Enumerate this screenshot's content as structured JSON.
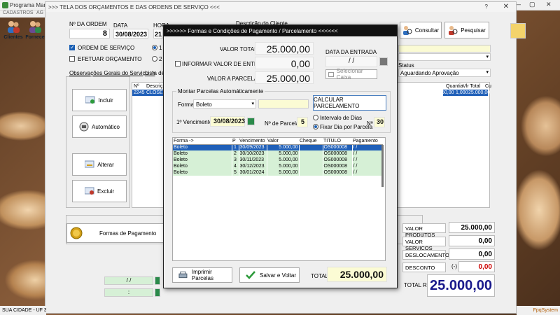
{
  "app": {
    "title": "Programa Mani",
    "menu": [
      "CADASTROS",
      "AG"
    ],
    "window_controls": {
      "minimize": "—",
      "maximize": "▢",
      "close": "✕"
    }
  },
  "toolbar": {
    "clientes": "Clientes",
    "fornece": "Fornece"
  },
  "main_form": {
    "title": ">>>  TELA DOS ORÇAMENTOS E DAS ORDENS DE SERVIÇO  <<<",
    "help": "?",
    "close": "✕",
    "numero_label": "Nº DA ORDEM",
    "numero_value": "8",
    "data_label": "DATA",
    "data_value": "30/08/2023",
    "hora_label": "HORA",
    "hora_value": "21",
    "ordem_servico": "ORDEM DE SERVIÇO",
    "efetuar_orcamento": "EFETUAR ORÇAMENTO",
    "radio1": "1",
    "radio2": "2",
    "descricao_cliente": "Descrição do Cliente",
    "consultar": "Consultar",
    "pesquisar": "Pesquisar",
    "status_label": "Status",
    "status_value": "Aguardando Aprovação",
    "tab_obs": "Observações Gerais do Serviço ->",
    "tab_lista": "Lista de P",
    "grid_head": [
      "Nº",
      "Descriç"
    ],
    "grid_row": [
      "2245",
      "CLOSET"
    ],
    "grid_right_head": [
      "",
      "Quantia",
      "Vlr Total",
      "Cu"
    ],
    "grid_right_row": [
      "50,00",
      "1,000",
      "25.000,00",
      ""
    ],
    "btn_incluir": "Incluir",
    "btn_automatico": "Automático",
    "btn_alterar": "Alterar",
    "btn_excluir": "Excluir",
    "btn_formas": "Formas de Pagamento",
    "date_slash": "/ /",
    "time_colon": ":",
    "valor_produtos_label": "VALOR PRODUTOS",
    "valor_produtos": "25.000,00",
    "valor_servicos_label": "VALOR SERVICOS",
    "valor_servicos": "0,00",
    "deslocamento_label": "DESLOCAMENTO",
    "deslocamento": "0,00",
    "desconto_label": "DESCONTO",
    "desconto_sign": "(-)",
    "desconto": "0,00",
    "total_label": "TOTAL R$",
    "total": "25.000,00"
  },
  "statusbar": {
    "left": "SUA CIDADE - UF 3",
    "right": "FpqSystem"
  },
  "modal": {
    "title": ">>>>>>  Formas e Condições de Pagamento / Parcelamento  <<<<<<",
    "valor_total_label": "VALOR TOTAL",
    "valor_total": "25.000,00",
    "informar_entrada": "INFORMAR VALOR DE ENTRADA",
    "entrada_value": "0,00",
    "valor_parcelar_label": "VALOR A PARCELAR",
    "valor_parcelar": "25.000,00",
    "data_entrada_label": "DATA DA ENTRADA",
    "data_entrada": "/ /",
    "selecionar_caixa": "Selecionar Caixa",
    "montar_label": "Montar Parcelas Automáticamente",
    "forma_label": "Forma:",
    "forma_value": "Boleto",
    "calcular": "CALCULAR  PARCELAMENTO",
    "vencimento_label": "1º Vencimento:",
    "vencimento_value": "30/08/2023",
    "nparcelas_label": "Nº de Parcelas",
    "nparcelas_value": "5",
    "intervalo_dias": "Intervalo de Dias",
    "fixar_dia": "Fixar Dia por Parcela",
    "n_label": "Nº",
    "n_value": "30",
    "table_head": [
      "Forma ->",
      "P",
      "Vencimento",
      "Valor",
      "Cheque",
      "TITULO",
      "Pagamento"
    ],
    "rows": [
      [
        "Boleto",
        "1",
        "30/09/2023",
        "5.000,00",
        "",
        "OS000008",
        "/  /"
      ],
      [
        "Boleto",
        "2",
        "30/10/2023",
        "5.000,00",
        "",
        "OS000008",
        "/  /"
      ],
      [
        "Boleto",
        "3",
        "30/11/2023",
        "5.000,00",
        "",
        "OS000008",
        "/  /"
      ],
      [
        "Boleto",
        "4",
        "30/12/2023",
        "5.000,00",
        "",
        "OS000008",
        "/  /"
      ],
      [
        "Boleto",
        "5",
        "30/01/2024",
        "5.000,00",
        "",
        "OS000008",
        "/  /"
      ]
    ],
    "imprimir": "Imprimir Parcelas",
    "salvar": "Salvar e Voltar",
    "total_label": "TOTAL",
    "total": "25.000,00"
  },
  "colors": {
    "selected_row": "#1f5fb8",
    "green_row": "#d6f0d6",
    "total_blue": "#1a1a8c",
    "desconto_red": "#cc0000"
  }
}
